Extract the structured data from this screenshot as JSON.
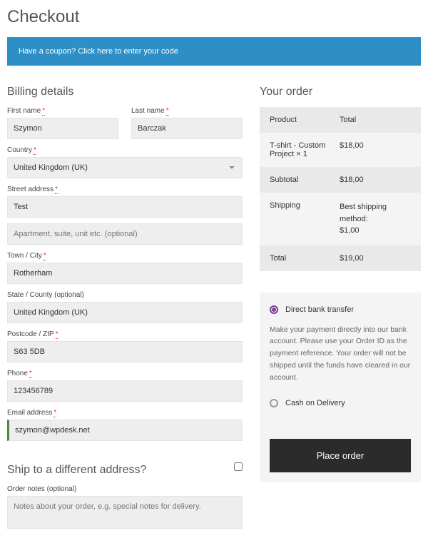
{
  "page": {
    "title": "Checkout"
  },
  "coupon": {
    "prompt": "Have a coupon?",
    "link": "Click here to enter your code"
  },
  "billing": {
    "heading": "Billing details",
    "first_name": {
      "label": "First name",
      "value": "Szymon"
    },
    "last_name": {
      "label": "Last name",
      "value": "Barczak"
    },
    "country": {
      "label": "Country",
      "value": "United Kingdom (UK)"
    },
    "street": {
      "label": "Street address",
      "value": "Test",
      "placeholder2": "Apartment, suite, unit etc. (optional)"
    },
    "city": {
      "label": "Town / City",
      "value": "Rotherham"
    },
    "state": {
      "label": "State / County (optional)",
      "value": "United Kingdom (UK)"
    },
    "postcode": {
      "label": "Postcode / ZIP",
      "value": "S63 5DB"
    },
    "phone": {
      "label": "Phone",
      "value": "123456789"
    },
    "email": {
      "label": "Email address",
      "value": "szymon@wpdesk.net"
    }
  },
  "ship_diff": {
    "heading": "Ship to a different address?"
  },
  "order_notes": {
    "label": "Order notes (optional)",
    "placeholder": "Notes about your order, e.g. special notes for delivery."
  },
  "order": {
    "heading": "Your order",
    "head_product": "Product",
    "head_total": "Total",
    "items": [
      {
        "name": "T-shirt - Custom Project  × 1",
        "total": "$18,00"
      }
    ],
    "subtotal_label": "Subtotal",
    "subtotal": "$18,00",
    "shipping_label": "Shipping",
    "shipping_method": "Best shipping method:",
    "shipping_price": "$1,00",
    "total_label": "Total",
    "total": "$19,00"
  },
  "payment": {
    "bank": {
      "label": "Direct bank transfer",
      "desc": "Make your payment directly into our bank account. Please use your Order ID as the payment reference. Your order will not be shipped until the funds have cleared in our account."
    },
    "cod": {
      "label": "Cash on Delivery"
    },
    "button": "Place order"
  }
}
